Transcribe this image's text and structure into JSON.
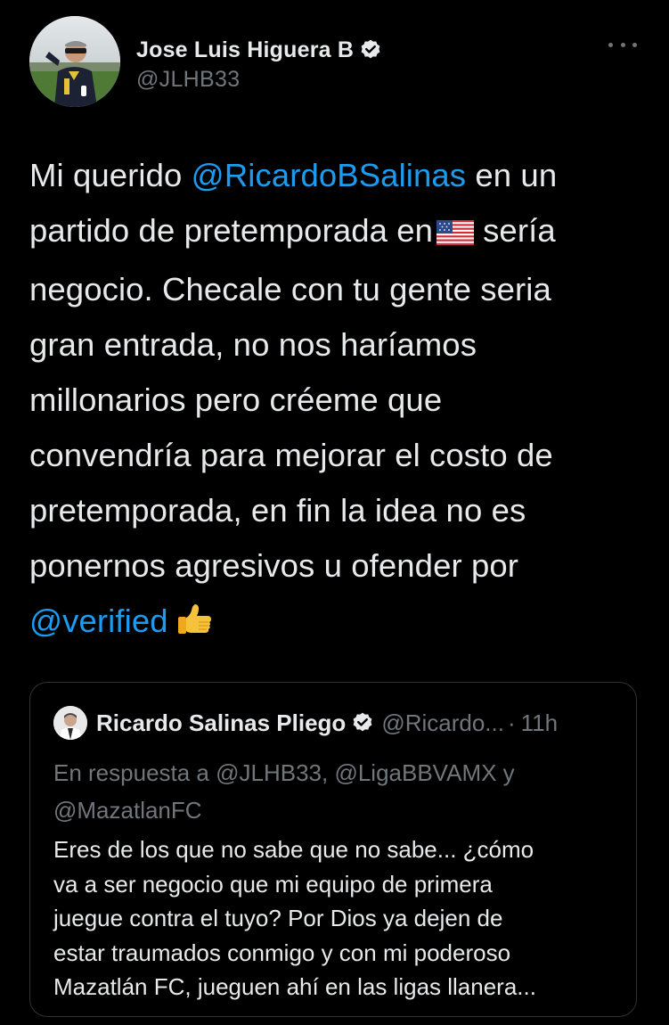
{
  "tweet": {
    "author": {
      "name": "Jose Luis Higuera B",
      "handle": "@JLHB33"
    },
    "text_lines": [
      {
        "pre": "Mi querido ",
        "mention": "@RicardoBSalinas",
        "post": " en un"
      },
      {
        "pre": "partido de pretemporada en",
        "post": "sería"
      },
      {
        "text": "negocio. Checale con tu gente seria"
      },
      {
        "text": "gran entrada, no nos haríamos"
      },
      {
        "text": "millonarios pero créeme que"
      },
      {
        "text": "convendría para mejorar el costo de"
      },
      {
        "text": "pretemporada, en fin la idea no es"
      },
      {
        "text": "ponernos agresivos u ofender por"
      },
      {
        "mention": "@verified"
      }
    ]
  },
  "quote": {
    "author": {
      "name": "Ricardo Salinas Pliego",
      "handle": "@Ricardo...",
      "separator": "·",
      "time": "11h"
    },
    "reply_lines": [
      "En respuesta a @JLHB33, @LigaBBVAMX y",
      "@MazatlanFC"
    ],
    "body_lines": [
      "Eres de los que no sabe que no sabe... ¿cómo",
      "va a ser negocio que mi equipo de primera",
      "juegue contra el tuyo? Por Dios ya dejen de",
      "estar traumados conmigo y con mi poderoso",
      "Mazatlán FC, jueguen ahí en las ligas llanera..."
    ]
  },
  "colors": {
    "background": "#000000",
    "text": "#e7e9ea",
    "secondary": "#71767b",
    "link": "#1d9bf0",
    "border": "#2f3336"
  },
  "icons": {
    "verified": "verified-badge-icon",
    "more": "more-options-icon",
    "flag": "us-flag-emoji",
    "thumb": "thumbs-up-emoji"
  }
}
